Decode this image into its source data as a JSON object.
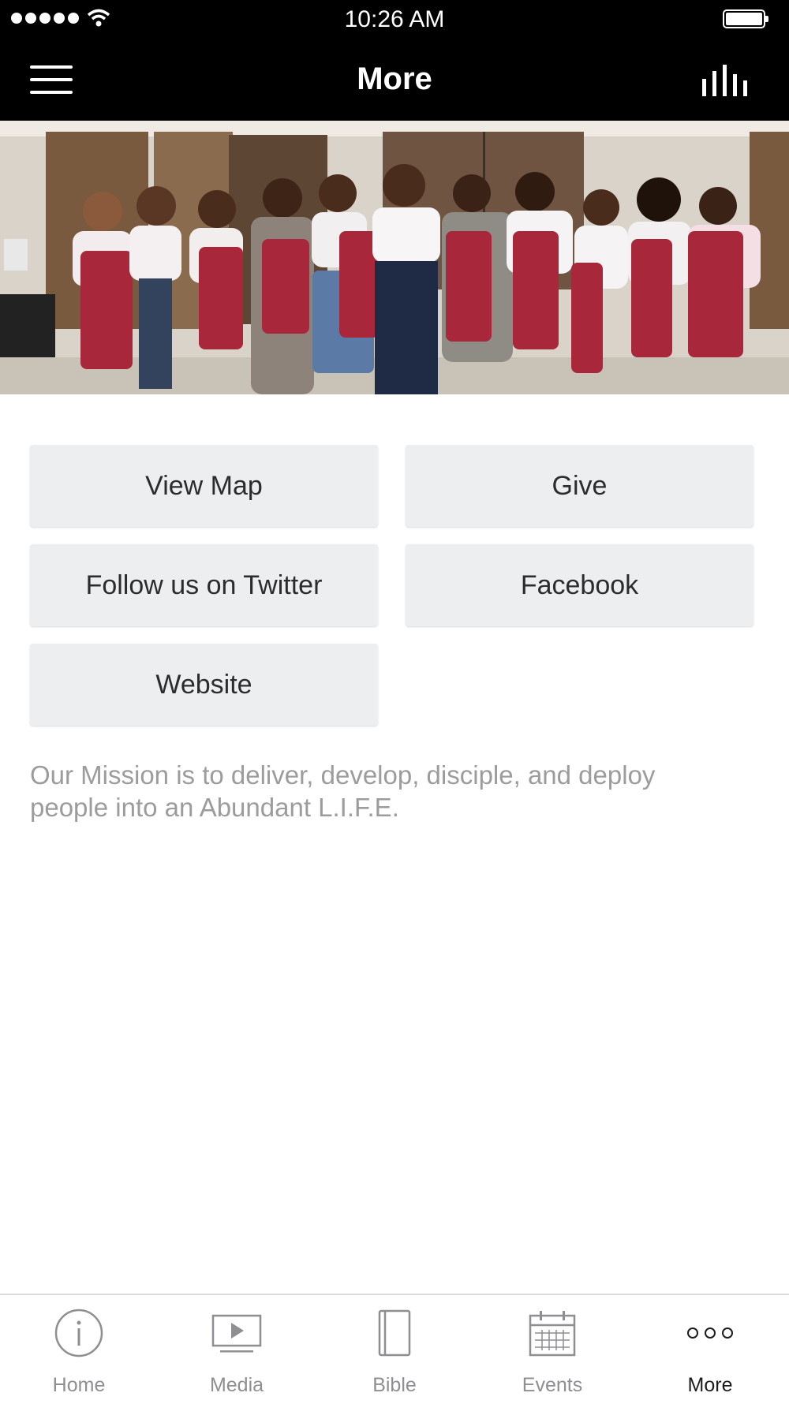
{
  "status_bar": {
    "time": "10:26 AM",
    "signal_icon": "signal-dots-icon",
    "wifi_icon": "wifi-icon",
    "battery_icon": "battery-icon"
  },
  "nav": {
    "title": "More",
    "menu_icon": "hamburger-menu-icon",
    "audio_icon": "audio-bars-icon"
  },
  "hero": {
    "image_icon": "group-photo-image"
  },
  "buttons": {
    "view_map": "View Map",
    "give": "Give",
    "twitter": "Follow us on Twitter",
    "facebook": "Facebook",
    "website": "Website"
  },
  "mission": "Our Mission is to deliver, develop, disciple, and deploy people into an Abundant L.I.F.E.",
  "tabs": [
    {
      "label": "Home",
      "icon": "info-icon",
      "active": false
    },
    {
      "label": "Media",
      "icon": "play-icon",
      "active": false
    },
    {
      "label": "Bible",
      "icon": "book-icon",
      "active": false
    },
    {
      "label": "Events",
      "icon": "calendar-icon",
      "active": false
    },
    {
      "label": "More",
      "icon": "more-dots-icon",
      "active": true
    }
  ],
  "colors": {
    "bar_background": "#000000",
    "button_background": "#edeef0",
    "mission_text": "#9c9c9e",
    "tab_inactive": "#8e8e93",
    "tab_active": "#1c1c1e",
    "apron_red": "#a8273a"
  }
}
